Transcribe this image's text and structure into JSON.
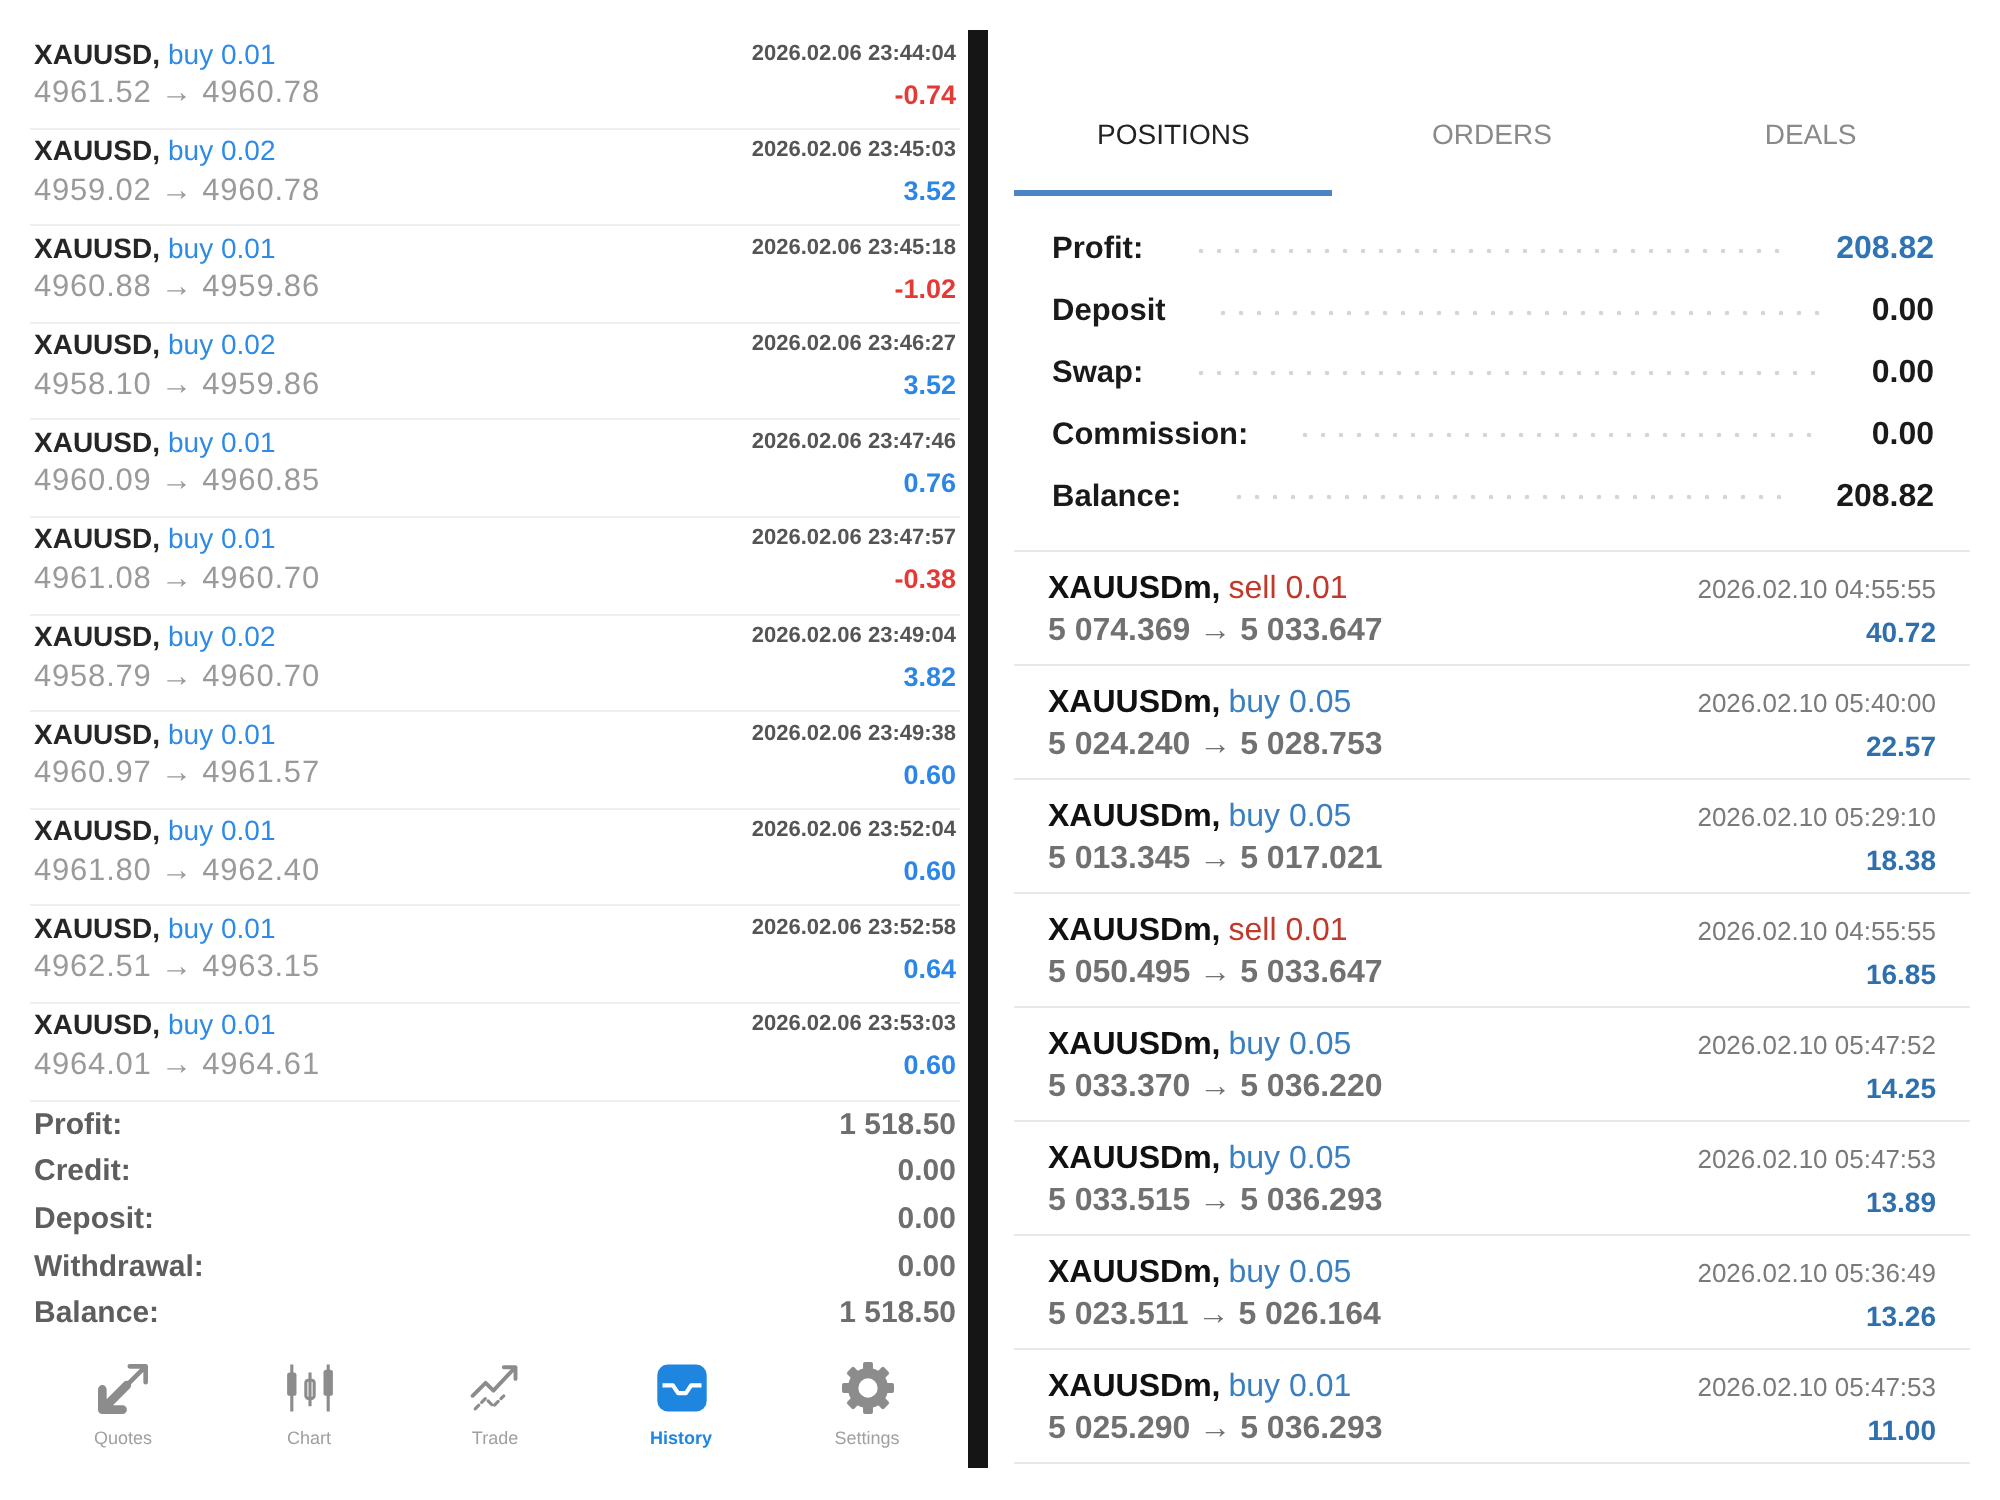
{
  "history": {
    "deals": [
      {
        "symbol": "XAUUSD,",
        "trade": "buy 0.01",
        "kind": "buy",
        "time": "2026.02.06 23:44:04",
        "prices": "4961.52 → 4960.78",
        "profit": "-0.74",
        "loss": true
      },
      {
        "symbol": "XAUUSD,",
        "trade": "buy 0.02",
        "kind": "buy",
        "time": "2026.02.06 23:45:03",
        "prices": "4959.02 → 4960.78",
        "profit": "3.52",
        "loss": false
      },
      {
        "symbol": "XAUUSD,",
        "trade": "buy 0.01",
        "kind": "buy",
        "time": "2026.02.06 23:45:18",
        "prices": "4960.88 → 4959.86",
        "profit": "-1.02",
        "loss": true
      },
      {
        "symbol": "XAUUSD,",
        "trade": "buy 0.02",
        "kind": "buy",
        "time": "2026.02.06 23:46:27",
        "prices": "4958.10 → 4959.86",
        "profit": "3.52",
        "loss": false
      },
      {
        "symbol": "XAUUSD,",
        "trade": "buy 0.01",
        "kind": "buy",
        "time": "2026.02.06 23:47:46",
        "prices": "4960.09 → 4960.85",
        "profit": "0.76",
        "loss": false
      },
      {
        "symbol": "XAUUSD,",
        "trade": "buy 0.01",
        "kind": "buy",
        "time": "2026.02.06 23:47:57",
        "prices": "4961.08 → 4960.70",
        "profit": "-0.38",
        "loss": true
      },
      {
        "symbol": "XAUUSD,",
        "trade": "buy 0.02",
        "kind": "buy",
        "time": "2026.02.06 23:49:04",
        "prices": "4958.79 → 4960.70",
        "profit": "3.82",
        "loss": false
      },
      {
        "symbol": "XAUUSD,",
        "trade": "buy 0.01",
        "kind": "buy",
        "time": "2026.02.06 23:49:38",
        "prices": "4960.97 → 4961.57",
        "profit": "0.60",
        "loss": false
      },
      {
        "symbol": "XAUUSD,",
        "trade": "buy 0.01",
        "kind": "buy",
        "time": "2026.02.06 23:52:04",
        "prices": "4961.80 → 4962.40",
        "profit": "0.60",
        "loss": false
      },
      {
        "symbol": "XAUUSD,",
        "trade": "buy 0.01",
        "kind": "buy",
        "time": "2026.02.06 23:52:58",
        "prices": "4962.51 → 4963.15",
        "profit": "0.64",
        "loss": false
      },
      {
        "symbol": "XAUUSD,",
        "trade": "buy 0.01",
        "kind": "buy",
        "time": "2026.02.06 23:53:03",
        "prices": "4964.01 → 4964.61",
        "profit": "0.60",
        "loss": false
      }
    ],
    "totals": [
      {
        "label": "Profit:",
        "value": "1 518.50"
      },
      {
        "label": "Credit:",
        "value": "0.00"
      },
      {
        "label": "Deposit:",
        "value": "0.00"
      },
      {
        "label": "Withdrawal:",
        "value": "0.00"
      },
      {
        "label": "Balance:",
        "value": "1 518.50"
      }
    ],
    "nav": [
      {
        "label": "Quotes",
        "selected": false
      },
      {
        "label": "Chart",
        "selected": false
      },
      {
        "label": "Trade",
        "selected": false
      },
      {
        "label": "History",
        "selected": true
      },
      {
        "label": "Settings",
        "selected": false
      }
    ]
  },
  "trade": {
    "tabs": [
      {
        "label": "POSITIONS",
        "selected": true
      },
      {
        "label": "ORDERS",
        "selected": false
      },
      {
        "label": "DEALS",
        "selected": false
      }
    ],
    "summary": [
      {
        "label": "Profit:",
        "value": "208.82",
        "highlighted": true
      },
      {
        "label": "Deposit",
        "value": "0.00",
        "highlighted": false
      },
      {
        "label": "Swap:",
        "value": "0.00",
        "highlighted": false
      },
      {
        "label": "Commission:",
        "value": "0.00",
        "highlighted": false
      },
      {
        "label": "Balance:",
        "value": "208.82",
        "highlighted": false
      }
    ],
    "positions": [
      {
        "symbol": "XAUUSDm,",
        "trade": "sell 0.01",
        "kind": "sell",
        "time": "2026.02.10 04:55:55",
        "prices": "5 074.369 → 5 033.647",
        "profit": "40.72",
        "loss": false
      },
      {
        "symbol": "XAUUSDm,",
        "trade": "buy 0.05",
        "kind": "buy",
        "time": "2026.02.10 05:40:00",
        "prices": "5 024.240 → 5 028.753",
        "profit": "22.57",
        "loss": false
      },
      {
        "symbol": "XAUUSDm,",
        "trade": "buy 0.05",
        "kind": "buy",
        "time": "2026.02.10 05:29:10",
        "prices": "5 013.345 → 5 017.021",
        "profit": "18.38",
        "loss": false
      },
      {
        "symbol": "XAUUSDm,",
        "trade": "sell 0.01",
        "kind": "sell",
        "time": "2026.02.10 04:55:55",
        "prices": "5 050.495 → 5 033.647",
        "profit": "16.85",
        "loss": false
      },
      {
        "symbol": "XAUUSDm,",
        "trade": "buy 0.05",
        "kind": "buy",
        "time": "2026.02.10 05:47:52",
        "prices": "5 033.370 → 5 036.220",
        "profit": "14.25",
        "loss": false
      },
      {
        "symbol": "XAUUSDm,",
        "trade": "buy 0.05",
        "kind": "buy",
        "time": "2026.02.10 05:47:53",
        "prices": "5 033.515 → 5 036.293",
        "profit": "13.89",
        "loss": false
      },
      {
        "symbol": "XAUUSDm,",
        "trade": "buy 0.05",
        "kind": "buy",
        "time": "2026.02.10 05:36:49",
        "prices": "5 023.511 → 5 026.164",
        "profit": "13.26",
        "loss": false
      },
      {
        "symbol": "XAUUSDm,",
        "trade": "buy 0.01",
        "kind": "buy",
        "time": "2026.02.10 05:47:53",
        "prices": "5 025.290 → 5 036.293",
        "profit": "11.00",
        "loss": false
      }
    ]
  }
}
